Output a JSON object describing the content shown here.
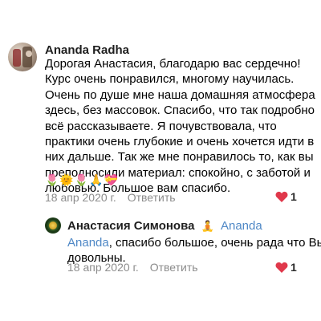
{
  "comment": {
    "author": "Ananda Radha",
    "lines": [
      "Дорогая Анастасия, благодарю вас сердечно!",
      "Курс очень понравился, многому научилась.",
      "Очень по душе мне наша домашняя атмосфера",
      "здесь, без массовок. Спасибо, что так подробно",
      "всё рассказываете. Я почувствовала, что",
      "практики очень глубокие и очень хочется идти в",
      "них дальше. Так же мне понравилось то, как вы",
      "преподносили материал: спокойно, с заботой и",
      "любовью. Большое вам спасибо."
    ],
    "emojis": "🌷🌞🌷🙏💝",
    "date": "18 апр 2020 г.",
    "reply_label": "Ответить",
    "likes": "1"
  },
  "reply": {
    "author": "Анастасия Симонова",
    "badge": "🧘",
    "reply_to": "Ananda",
    "mention": "Ananda",
    "text_line1": ", спасибо большое, очень рада что Вы",
    "text_line2": "довольны.",
    "date": "18 апр 2020 г.",
    "reply_label": "Ответить",
    "likes": "1"
  },
  "colors": {
    "like_heart": "#e0384b",
    "link_blue": "#4f88c6",
    "meta_gray": "#8c8c8c"
  }
}
